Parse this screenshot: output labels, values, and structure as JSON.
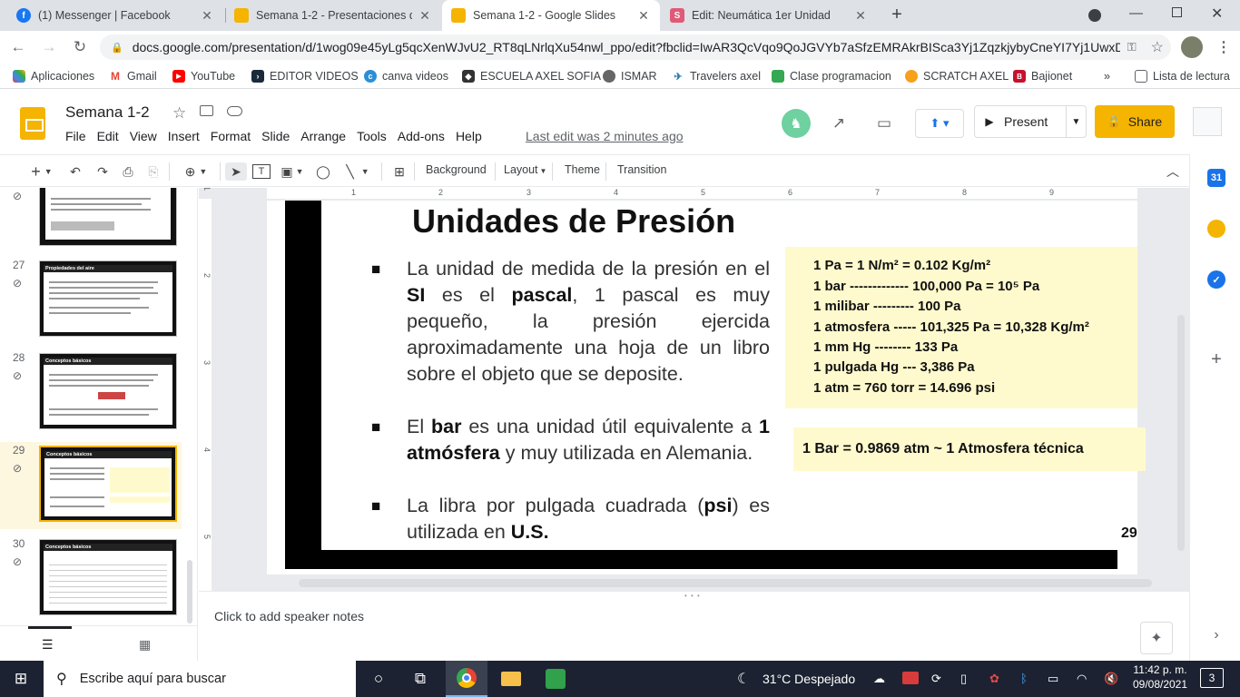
{
  "browser": {
    "tabs": [
      {
        "title": "(1) Messenger | Facebook",
        "icon": "facebook-icon",
        "color": "#1877f2"
      },
      {
        "title": "Semana 1-2 - Presentaciones de",
        "icon": "slides-icon",
        "color": "#f4b400"
      },
      {
        "title": "Semana 1-2 - Google Slides",
        "icon": "slides-icon",
        "color": "#f4b400"
      },
      {
        "title": "Edit: Neumática 1er Unidad",
        "icon": "edit-s-icon",
        "color": "#e05a78"
      }
    ],
    "url": "docs.google.com/presentation/d/1wog09e45yLg5qcXenWJvU2_RT8qLNrlqXu54nwl_ppo/edit?fbclid=IwAR3QcVqo9QoJGVYb7aSfzEMRAkrBISca3Yj1ZqzkjybyCneYI7Yj1UwxD...",
    "bookmarks": [
      "Aplicaciones",
      "Gmail",
      "YouTube",
      "EDITOR VIDEOS",
      "canva videos",
      "ESCUELA AXEL SOFIA",
      "ISMAR",
      "Travelers axel",
      "Clase programacion",
      "SCRATCH AXEL",
      "Bajionet"
    ],
    "reading_list": "Lista de lectura",
    "more": "»"
  },
  "doc": {
    "title": "Semana 1-2",
    "menu": [
      "File",
      "Edit",
      "View",
      "Insert",
      "Format",
      "Slide",
      "Arrange",
      "Tools",
      "Add-ons",
      "Help"
    ],
    "last_edit": "Last edit was 2 minutes ago",
    "present": "Present",
    "share": "Share"
  },
  "toolbar": {
    "background": "Background",
    "layout": "Layout",
    "theme": "Theme",
    "transition": "Transition"
  },
  "filmstrip": [
    {
      "num": "",
      "title": ""
    },
    {
      "num": "27",
      "title": "Propiedades del aire"
    },
    {
      "num": "28",
      "title": "Conceptos básicos"
    },
    {
      "num": "29",
      "title": "Conceptos básicos"
    },
    {
      "num": "30",
      "title": "Conceptos básicos"
    }
  ],
  "ruler": {
    "h": [
      "1",
      "2",
      "3",
      "4",
      "5",
      "6",
      "7",
      "8",
      "9"
    ],
    "v": [
      "1",
      "2",
      "3",
      "4",
      "5"
    ]
  },
  "slide": {
    "title": "Unidades de Presión",
    "p1_a": "La unidad de medida de la presión en el ",
    "p1_si": "SI",
    "p1_b": " es el ",
    "p1_pascal": "pascal",
    "p1_c": ",  1 pascal es muy pequeño, la presión ejercida aproximadamente una hoja de un libro sobre el objeto que se deposite.",
    "p2_a": "El ",
    "p2_bar": "bar",
    "p2_b": " es una unidad útil equivalente a ",
    "p2_atm": "1 atmósfera",
    "p2_c": " y muy utilizada en Alemania.",
    "p3_a": "La libra por pulgada cuadrada (",
    "p3_psi": "psi",
    "p3_b": ") es utilizada en ",
    "p3_us": "U.S.",
    "conversions": [
      "1 Pa = 1 N/m² = 0.102  Kg/m²",
      "1 bar ------------- 100,000  Pa = 10⁵ Pa",
      "1 milibar --------- 100 Pa",
      "1 atmosfera ----- 101,325  Pa = 10,328  Kg/m²",
      "1 mm Hg -------- 133 Pa",
      "1 pulgada Hg --- 3,386  Pa",
      "1 atm = 760 torr = 14.696  psi"
    ],
    "bar_note": "1 Bar = 0.9869  atm ~ 1 Atmosfera técnica",
    "number": "29"
  },
  "notes": {
    "placeholder": "Click to add speaker notes"
  },
  "taskbar": {
    "search": "Escribe aquí para buscar",
    "weather": "31°C  Despejado",
    "time": "11:42 p. m.",
    "date": "09/08/2021",
    "notifications": "3"
  }
}
